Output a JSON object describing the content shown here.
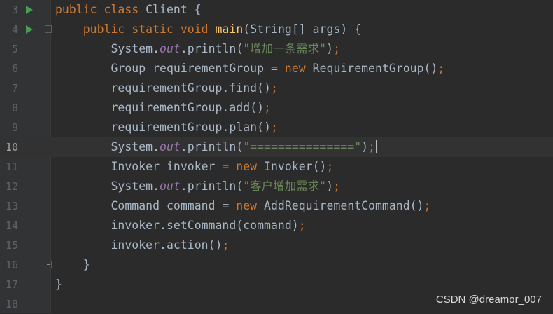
{
  "editor": {
    "current_line": "10",
    "lines": [
      {
        "num": "3",
        "run": true,
        "fold": false,
        "indent": "",
        "tokens": [
          [
            "kw",
            "public"
          ],
          [
            "pl",
            " "
          ],
          [
            "kw",
            "class"
          ],
          [
            "pl",
            " Client {"
          ]
        ]
      },
      {
        "num": "4",
        "run": true,
        "fold": true,
        "indent": "    ",
        "tokens": [
          [
            "kw",
            "public"
          ],
          [
            "pl",
            " "
          ],
          [
            "kw",
            "static"
          ],
          [
            "pl",
            " "
          ],
          [
            "kw",
            "void"
          ],
          [
            "pl",
            " "
          ],
          [
            "fn",
            "main"
          ],
          [
            "pl",
            "(String[] args) {"
          ]
        ]
      },
      {
        "num": "5",
        "run": false,
        "fold": false,
        "indent": "        ",
        "tokens": [
          [
            "pl",
            "System."
          ],
          [
            "fld",
            "out"
          ],
          [
            "pl",
            ".println("
          ],
          [
            "str",
            "\"增加一条需求\""
          ],
          [
            "pl",
            ")"
          ],
          [
            "kw",
            ";"
          ]
        ]
      },
      {
        "num": "6",
        "run": false,
        "fold": false,
        "indent": "        ",
        "tokens": [
          [
            "pl",
            "Group requirementGroup = "
          ],
          [
            "kw",
            "new"
          ],
          [
            "pl",
            " RequirementGroup()"
          ],
          [
            "kw",
            ";"
          ]
        ]
      },
      {
        "num": "7",
        "run": false,
        "fold": false,
        "indent": "        ",
        "tokens": [
          [
            "pl",
            "requirementGroup.find()"
          ],
          [
            "kw",
            ";"
          ]
        ]
      },
      {
        "num": "8",
        "run": false,
        "fold": false,
        "indent": "        ",
        "tokens": [
          [
            "pl",
            "requirementGroup.add()"
          ],
          [
            "kw",
            ";"
          ]
        ]
      },
      {
        "num": "9",
        "run": false,
        "fold": false,
        "indent": "        ",
        "tokens": [
          [
            "pl",
            "requirementGroup.plan()"
          ],
          [
            "kw",
            ";"
          ]
        ]
      },
      {
        "num": "10",
        "run": false,
        "fold": false,
        "indent": "        ",
        "cursor": true,
        "tokens": [
          [
            "pl",
            "System."
          ],
          [
            "fld",
            "out"
          ],
          [
            "pl",
            ".println("
          ],
          [
            "str",
            "\"===============\""
          ],
          [
            "pl",
            ")"
          ],
          [
            "kw",
            ";"
          ]
        ]
      },
      {
        "num": "11",
        "run": false,
        "fold": false,
        "indent": "        ",
        "tokens": [
          [
            "pl",
            "Invoker invoker = "
          ],
          [
            "kw",
            "new"
          ],
          [
            "pl",
            " Invoker()"
          ],
          [
            "kw",
            ";"
          ]
        ]
      },
      {
        "num": "12",
        "run": false,
        "fold": false,
        "indent": "        ",
        "tokens": [
          [
            "pl",
            "System."
          ],
          [
            "fld",
            "out"
          ],
          [
            "pl",
            ".println("
          ],
          [
            "str",
            "\"客户增加需求\""
          ],
          [
            "pl",
            ")"
          ],
          [
            "kw",
            ";"
          ]
        ]
      },
      {
        "num": "13",
        "run": false,
        "fold": false,
        "indent": "        ",
        "tokens": [
          [
            "pl",
            "Command command = "
          ],
          [
            "kw",
            "new"
          ],
          [
            "pl",
            " AddRequirementCommand()"
          ],
          [
            "kw",
            ";"
          ]
        ]
      },
      {
        "num": "14",
        "run": false,
        "fold": false,
        "indent": "        ",
        "tokens": [
          [
            "pl",
            "invoker.setCommand(command)"
          ],
          [
            "kw",
            ";"
          ]
        ]
      },
      {
        "num": "15",
        "run": false,
        "fold": false,
        "indent": "        ",
        "tokens": [
          [
            "pl",
            "invoker.action()"
          ],
          [
            "kw",
            ";"
          ]
        ]
      },
      {
        "num": "16",
        "run": false,
        "fold": true,
        "indent": "    ",
        "tokens": [
          [
            "pl",
            "}"
          ]
        ]
      },
      {
        "num": "17",
        "run": false,
        "fold": false,
        "indent": "",
        "tokens": [
          [
            "pl",
            "}"
          ]
        ]
      },
      {
        "num": "18",
        "run": false,
        "fold": false,
        "indent": "",
        "tokens": []
      }
    ]
  },
  "watermark": "CSDN @dreamor_007",
  "colors": {
    "background": "#2b2b2b",
    "gutter": "#313335",
    "keyword": "#cc7832",
    "method_decl": "#ffc66d",
    "static_field": "#9876aa",
    "string": "#6a8759",
    "plain": "#a9b7c6",
    "line_number": "#606366",
    "run_icon": "#499c54"
  },
  "icons": {
    "run": "run-gutter-icon",
    "fold": "fold-marker-icon"
  }
}
